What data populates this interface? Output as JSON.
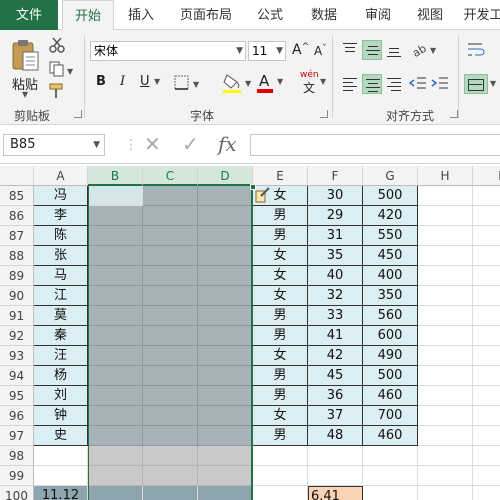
{
  "tabs": [
    "文件",
    "开始",
    "插入",
    "页面布局",
    "公式",
    "数据",
    "审阅",
    "视图",
    "开发工"
  ],
  "ribbon": {
    "paste_label": "粘贴",
    "font_name": "宋体",
    "font_size": "11",
    "bold": "B",
    "italic": "I",
    "underline": "U",
    "font_color_glyph": "A",
    "wen_glyph": "wén",
    "wen_char": "文",
    "grow_glyph": "A",
    "shrink_glyph": "A",
    "group_clipboard": "剪贴板",
    "group_font": "字体",
    "group_alignment": "对齐方式"
  },
  "formula_bar": {
    "name_box": "B85",
    "cancel_glyph": "✕",
    "enter_glyph": "✓",
    "fx_glyph": "fx",
    "formula": ""
  },
  "sheet": {
    "columns": [
      "A",
      "B",
      "C",
      "D",
      "E",
      "F",
      "G",
      "H",
      "I"
    ],
    "selected_columns": [
      "B",
      "C",
      "D"
    ],
    "active_cell": "B85",
    "rows": [
      {
        "n": "85",
        "A": "冯",
        "E": "女",
        "F": "30",
        "G": "500"
      },
      {
        "n": "86",
        "A": "李",
        "E": "男",
        "F": "29",
        "G": "420"
      },
      {
        "n": "87",
        "A": "陈",
        "E": "男",
        "F": "31",
        "G": "550"
      },
      {
        "n": "88",
        "A": "张",
        "E": "女",
        "F": "35",
        "G": "450"
      },
      {
        "n": "89",
        "A": "马",
        "E": "女",
        "F": "40",
        "G": "400"
      },
      {
        "n": "90",
        "A": "江",
        "E": "女",
        "F": "32",
        "G": "350"
      },
      {
        "n": "91",
        "A": "莫",
        "E": "男",
        "F": "33",
        "G": "560"
      },
      {
        "n": "92",
        "A": "秦",
        "E": "男",
        "F": "41",
        "G": "600"
      },
      {
        "n": "93",
        "A": "汪",
        "E": "女",
        "F": "42",
        "G": "490"
      },
      {
        "n": "94",
        "A": "杨",
        "E": "男",
        "F": "45",
        "G": "500"
      },
      {
        "n": "95",
        "A": "刘",
        "E": "男",
        "F": "36",
        "G": "460"
      },
      {
        "n": "96",
        "A": "钟",
        "E": "女",
        "F": "37",
        "G": "700"
      },
      {
        "n": "97",
        "A": "史",
        "E": "男",
        "F": "48",
        "G": "460"
      },
      {
        "n": "98"
      },
      {
        "n": "99"
      },
      {
        "n": "100",
        "A": "11.12",
        "F": "6.41"
      }
    ]
  },
  "colors": {
    "accent": "#217346",
    "data_fill": "#dbeef3",
    "selection_fill": "#a6b3b8",
    "peach_fill": "#fbd3b5",
    "font_red": "#e00000"
  }
}
